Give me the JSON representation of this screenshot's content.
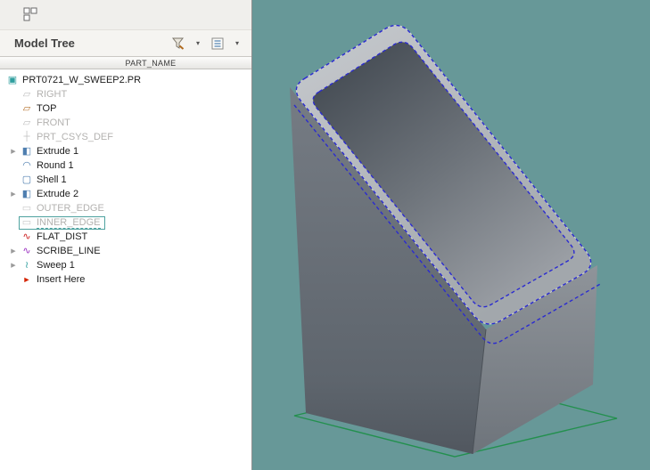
{
  "colors": {
    "viewport-bg": "#679898",
    "sketch-green": "#23904e",
    "highlight-blue": "#2b2bd0",
    "panel-bg": "#ffffff",
    "chrome-bg": "#f0efec",
    "feature-red": "#cc2020"
  },
  "panel": {
    "title": "Model Tree",
    "column_header": "PART_NAME",
    "toolbar": {
      "filter_button_icon": "settings-filter-icon",
      "list_button_icon": "view-list-icon"
    },
    "tree": [
      {
        "label": "PRT0721_W_SWEEP2.PR",
        "icon": "part",
        "depth": 0
      },
      {
        "label": "RIGHT",
        "icon": "datum_plane",
        "depth": 1,
        "muted": true
      },
      {
        "label": "TOP",
        "icon": "datum_plane_top",
        "depth": 1
      },
      {
        "label": "FRONT",
        "icon": "datum_plane",
        "depth": 1,
        "muted": true
      },
      {
        "label": "PRT_CSYS_DEF",
        "icon": "csys",
        "depth": 1,
        "muted": true
      },
      {
        "label": "Extrude 1",
        "icon": "extrude",
        "depth": 1,
        "arrow": true
      },
      {
        "label": "Round 1",
        "icon": "round",
        "depth": 1
      },
      {
        "label": "Shell 1",
        "icon": "shell",
        "depth": 1
      },
      {
        "label": "Extrude 2",
        "icon": "extrude",
        "depth": 1,
        "arrow": true
      },
      {
        "label": "OUTER_EDGE",
        "icon": "edge_curve",
        "depth": 1,
        "muted": true
      },
      {
        "label": "INNER_EDGE",
        "icon": "edge_curve",
        "depth": 1,
        "muted": true,
        "selected": true
      },
      {
        "label": "FLAT_DIST",
        "icon": "curve_red",
        "depth": 1
      },
      {
        "label": "SCRIBE_LINE",
        "icon": "curve_purple",
        "depth": 1,
        "arrow": true
      },
      {
        "label": "Sweep 1",
        "icon": "sweep",
        "depth": 1,
        "arrow": true
      },
      {
        "label": "Insert Here",
        "icon": "insert_here",
        "depth": 1
      }
    ]
  },
  "icons": {
    "expand": "▶",
    "caret": "▾",
    "part": "▣",
    "datum_plane": "▱",
    "datum_plane_top": "▱",
    "csys": "┼",
    "extrude": "◧",
    "round": "◠",
    "shell": "▢",
    "edge_curve": "▭",
    "curve_red": "∿",
    "curve_purple": "∿",
    "sweep": "≀",
    "insert_here": "►"
  }
}
